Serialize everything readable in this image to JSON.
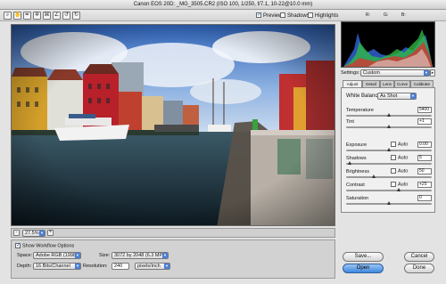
{
  "window": {
    "title": "Canon EOS 20D:  _MG_3505.CR2  (ISO 100, 1/250, f/7.1, 10-22@10.0 mm)"
  },
  "toolbar": {
    "tools": [
      "zoom-icon",
      "hand-icon",
      "eyedropper-icon",
      "color-sampler-icon",
      "crop-icon",
      "straighten-icon",
      "rotate-left-icon",
      "rotate-right-icon"
    ],
    "preview_label": "Preview",
    "shadows_label": "Shadows",
    "highlights_label": "Highlights"
  },
  "histogram": {
    "r_label": "R:",
    "g_label": "G:",
    "b_label": "B:",
    "r_value": "",
    "g_value": "",
    "b_value": ""
  },
  "zoom": {
    "minus": "-",
    "plus": "+",
    "value": "27.5%"
  },
  "workflow": {
    "toggle_label": "Show Workflow Options",
    "space_label": "Space:",
    "space_value": "Adobe RGB (1998)",
    "depth_label": "Depth:",
    "depth_value": "16 Bits/Channel",
    "size_label": "Size:",
    "size_value": "3072 by 2048 (6.3 MP)",
    "resolution_label": "Resolution:",
    "resolution_value": "240",
    "res_unit_value": "pixels/inch"
  },
  "settings": {
    "label": "Settings:",
    "value": "Custom"
  },
  "tabs": [
    "Adjust",
    "Detail",
    "Lens",
    "Curve",
    "Calibrate"
  ],
  "adjust": {
    "white_balance_label": "White Balance:",
    "white_balance_value": "As Shot",
    "auto_label": "Auto",
    "rows": [
      {
        "label": "Temperature",
        "value": "5400",
        "level": 0.5,
        "auto": false
      },
      {
        "label": "Tint",
        "value": "+1",
        "level": 0.51,
        "auto": false
      },
      {
        "label": "Exposure",
        "value": "0.00",
        "level": 0.5,
        "auto": true
      },
      {
        "label": "Shadows",
        "value": "5",
        "level": 0.05,
        "auto": true
      },
      {
        "label": "Brightness",
        "value": "50",
        "level": 0.33,
        "auto": true
      },
      {
        "label": "Contrast",
        "value": "+25",
        "level": 0.62,
        "auto": true
      },
      {
        "label": "Saturation",
        "value": "0",
        "level": 0.5,
        "auto": false
      }
    ]
  },
  "buttons": {
    "save": "Save...",
    "cancel": "Cancel",
    "open": "Open",
    "done": "Done"
  },
  "colors": {
    "accent": "#3e86dd",
    "histogram_bg": "#000000"
  }
}
